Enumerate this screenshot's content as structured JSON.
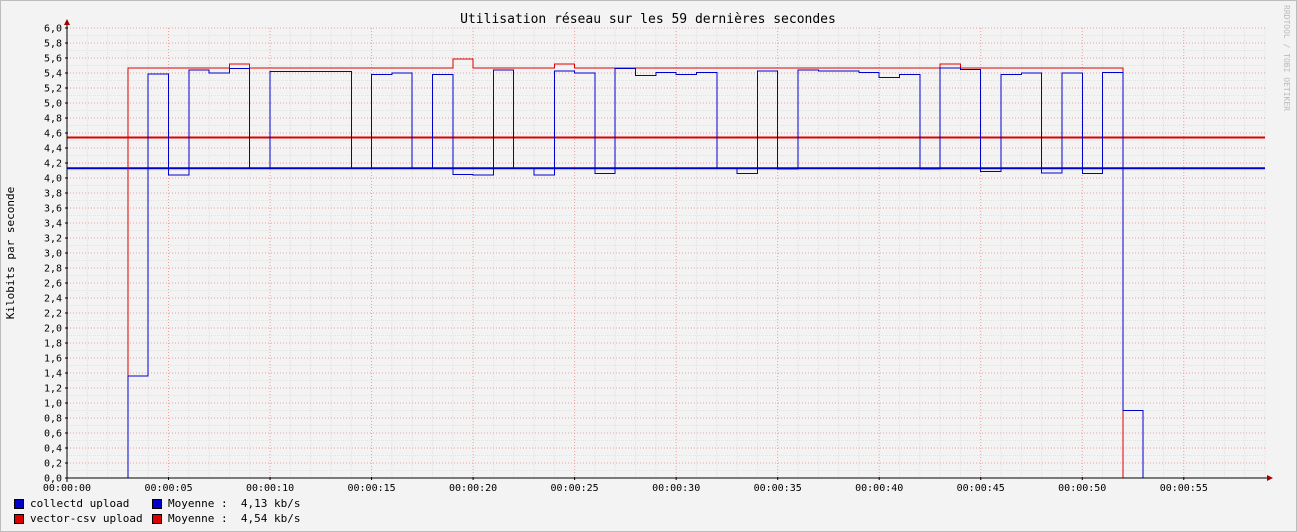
{
  "chart_data": {
    "type": "line",
    "title": "Utilisation réseau sur les 59 dernières secondes",
    "ylabel": "Kilobits par seconde",
    "watermark": "RRDTOOL / TOBI OETIKER",
    "ylim": [
      0,
      6.0
    ],
    "xlim": [
      0,
      59
    ],
    "y_ticks": [
      "0,0",
      "0,2",
      "0,4",
      "0,6",
      "0,8",
      "1,0",
      "1,2",
      "1,4",
      "1,6",
      "1,8",
      "2,0",
      "2,2",
      "2,4",
      "2,6",
      "2,8",
      "3,0",
      "3,2",
      "3,4",
      "3,6",
      "3,8",
      "4,0",
      "4,2",
      "4,4",
      "4,6",
      "4,8",
      "5,0",
      "5,2",
      "5,4",
      "5,6",
      "5,8",
      "6,0"
    ],
    "x_ticks": [
      "00:00:00",
      "00:00:05",
      "00:00:10",
      "00:00:15",
      "00:00:20",
      "00:00:25",
      "00:00:30",
      "00:00:35",
      "00:00:40",
      "00:00:45",
      "00:00:50",
      "00:00:55"
    ],
    "grid": true,
    "legend_position": "bottom-left",
    "series": [
      {
        "name": "collectd upload",
        "color": "#0000cc",
        "step": true,
        "x": [
          0,
          1,
          2,
          3,
          4,
          5,
          6,
          7,
          8,
          9,
          10,
          11,
          12,
          13,
          14,
          15,
          16,
          17,
          18,
          19,
          20,
          21,
          22,
          23,
          24,
          25,
          26,
          27,
          28,
          29,
          30,
          31,
          32,
          33,
          34,
          35,
          36,
          37,
          38,
          39,
          40,
          41,
          42,
          43,
          44,
          45,
          46,
          47,
          48,
          49,
          50,
          51,
          52,
          53,
          54,
          55,
          56,
          57,
          58
        ],
        "values": [
          0,
          0,
          0,
          1.36,
          5.39,
          4.04,
          5.44,
          5.4,
          5.46,
          4.13,
          5.42,
          5.42,
          5.42,
          5.42,
          4.13,
          5.38,
          5.4,
          4.13,
          5.38,
          4.05,
          4.04,
          5.44,
          4.13,
          4.04,
          5.43,
          5.4,
          4.06,
          5.46,
          5.37,
          5.41,
          5.38,
          5.41,
          4.13,
          4.06,
          5.43,
          4.12,
          5.44,
          5.43,
          5.43,
          5.41,
          5.34,
          5.38,
          4.12,
          5.47,
          5.45,
          4.09,
          5.38,
          5.4,
          4.07,
          5.4,
          4.06,
          5.41,
          0.9,
          0,
          0,
          0,
          0,
          0,
          0
        ]
      },
      {
        "name": "vector-csv upload",
        "color": "#dd0000",
        "step": true,
        "x": [
          0,
          1,
          2,
          3,
          4,
          5,
          6,
          7,
          8,
          9,
          10,
          11,
          12,
          13,
          14,
          15,
          16,
          17,
          18,
          19,
          20,
          21,
          22,
          23,
          24,
          25,
          26,
          27,
          28,
          29,
          30,
          31,
          32,
          33,
          34,
          35,
          36,
          37,
          38,
          39,
          40,
          41,
          42,
          43,
          44,
          45,
          46,
          47,
          48,
          49,
          50,
          51,
          52,
          53,
          54,
          55,
          56,
          57,
          58
        ],
        "values": [
          0,
          0,
          0,
          5.47,
          5.47,
          5.47,
          5.47,
          5.47,
          5.52,
          5.47,
          5.47,
          5.47,
          5.47,
          5.47,
          5.47,
          5.47,
          5.47,
          5.47,
          5.47,
          5.59,
          5.47,
          5.47,
          5.47,
          5.47,
          5.52,
          5.47,
          5.47,
          5.47,
          5.47,
          5.47,
          5.47,
          5.47,
          5.47,
          5.47,
          5.47,
          5.47,
          5.47,
          5.47,
          5.47,
          5.47,
          5.47,
          5.47,
          5.47,
          5.52,
          5.47,
          5.47,
          5.47,
          5.47,
          5.47,
          5.47,
          5.47,
          5.47,
          0,
          0,
          0,
          0,
          0,
          0,
          0
        ]
      }
    ],
    "averages": [
      {
        "series": "collectd upload",
        "value": 4.13,
        "color": "#0000cc"
      },
      {
        "series": "vector-csv upload",
        "value": 4.54,
        "color": "#dd0000"
      }
    ]
  },
  "legend": [
    {
      "name": "collectd upload",
      "avg_label": "Moyenne :  4,13 kb/s",
      "color": "#0000cc"
    },
    {
      "name": "vector-csv upload",
      "avg_label": "Moyenne :  4,54 kb/s",
      "color": "#dd0000"
    }
  ]
}
